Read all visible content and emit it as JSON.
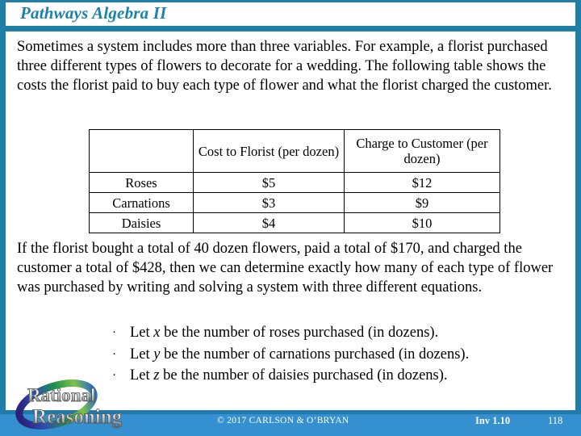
{
  "slide": {
    "title": "Pathways Algebra II",
    "accent_color": "#1f7fa6",
    "title_color": "#1b82ab",
    "footer_color": "#3590cf"
  },
  "body": {
    "intro_paragraph": "Sometimes a system includes more than three variables. For example, a florist purchased three different types of flowers to decorate for a wedding. The following table shows the costs the florist paid to buy each type of flower and what the florist charged the customer.",
    "second_paragraph": "If the florist bought a total of 40 dozen flowers, paid a total of $170, and charged the customer a total of $428, then we can determine exactly how many of each type of flower was purchased by writing and solving a system with three different equations."
  },
  "table": {
    "headers": [
      "",
      "Cost to Florist (per dozen)",
      "Charge to Customer (per dozen)"
    ],
    "rows": [
      {
        "label": "Roses",
        "cost": "$5",
        "charge": "$12"
      },
      {
        "label": "Carnations",
        "cost": "$3",
        "charge": "$9"
      },
      {
        "label": "Daisies",
        "cost": "$4",
        "charge": "$10"
      }
    ]
  },
  "bullets": {
    "marker": "·",
    "items": [
      {
        "pre": "Let ",
        "var": "x",
        "post": " be the number of roses purchased (in dozens)."
      },
      {
        "pre": "Let ",
        "var": "y",
        "post": " be the number of carnations purchased (in dozens)."
      },
      {
        "pre": "Let ",
        "var": "z",
        "post": " be the number of daisies purchased (in dozens)."
      }
    ]
  },
  "footer": {
    "copyright": "© 2017 CARLSON & O’BRYAN",
    "investigation": "Inv 1.10",
    "page_number": "118"
  },
  "logo": {
    "line1": "Rational",
    "line2": "Reasoning"
  }
}
